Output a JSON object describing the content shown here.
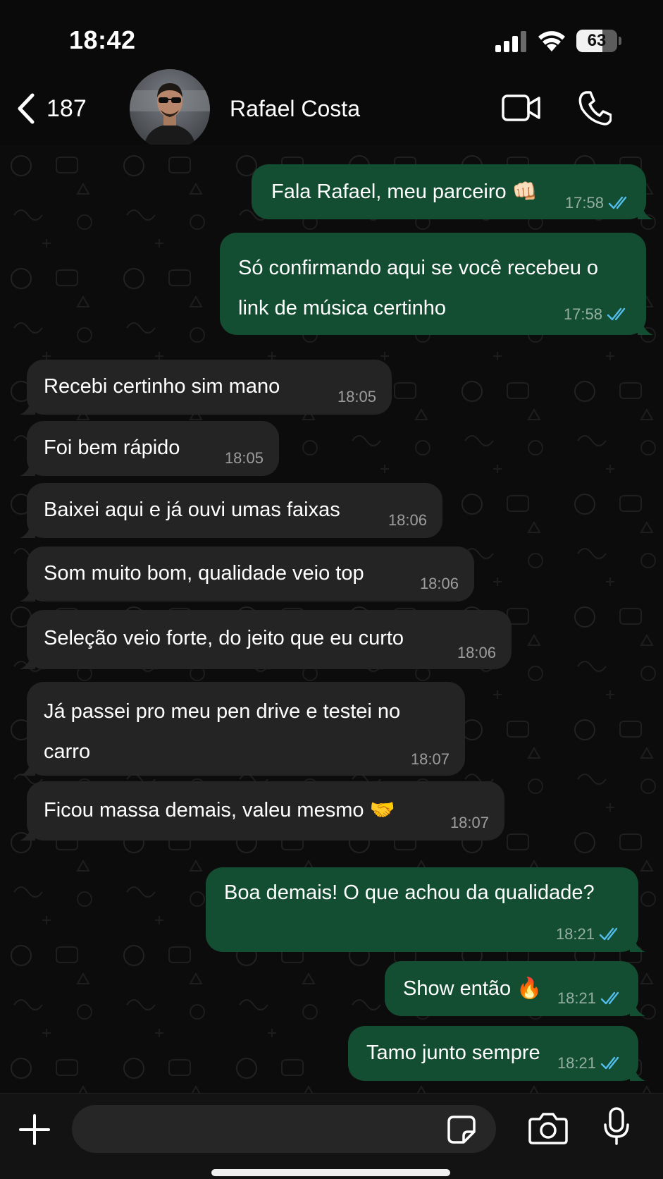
{
  "status_bar": {
    "time": "18:42",
    "battery_level": "63"
  },
  "header": {
    "back_count": "187",
    "contact_name": "Rafael Costa"
  },
  "colors": {
    "outgoing_bubble": "#134d32",
    "incoming_bubble": "#242424",
    "read_ticks": "#53bdeb",
    "background": "#0c0c0c"
  },
  "icons": {
    "back": "chevron-left-icon",
    "video": "video-camera-icon",
    "call": "phone-icon",
    "plus": "plus-icon",
    "sticker": "sticker-icon",
    "camera": "camera-icon",
    "mic": "microphone-icon",
    "read": "double-check-icon"
  },
  "messages": [
    {
      "direction": "out",
      "text": "Fala Rafael, meu parceiro 👊🏻",
      "time": "17:58",
      "status": "read"
    },
    {
      "direction": "out",
      "text": "Só confirmando aqui se você recebeu o link de música certinho",
      "time": "17:58",
      "status": "read"
    },
    {
      "direction": "in",
      "text": "Recebi certinho sim mano",
      "time": "18:05"
    },
    {
      "direction": "in",
      "text": "Foi bem rápido",
      "time": "18:05"
    },
    {
      "direction": "in",
      "text": "Baixei aqui e já ouvi umas faixas",
      "time": "18:06"
    },
    {
      "direction": "in",
      "text": "Som muito bom, qualidade veio top",
      "time": "18:06"
    },
    {
      "direction": "in",
      "text": "Seleção veio forte, do jeito que eu curto",
      "time": "18:06"
    },
    {
      "direction": "in",
      "text": "Já passei pro meu pen drive e testei no carro",
      "time": "18:07"
    },
    {
      "direction": "in",
      "text": "Ficou massa demais, valeu mesmo 🤝",
      "time": "18:07"
    },
    {
      "direction": "out",
      "text": "Boa demais! O que achou da qualidade?",
      "time": "18:21",
      "status": "read"
    },
    {
      "direction": "out",
      "text": "Show então 🔥",
      "time": "18:21",
      "status": "read"
    },
    {
      "direction": "out",
      "text": "Tamo junto sempre",
      "time": "18:21",
      "status": "read"
    }
  ],
  "composer": {
    "input_value": ""
  }
}
